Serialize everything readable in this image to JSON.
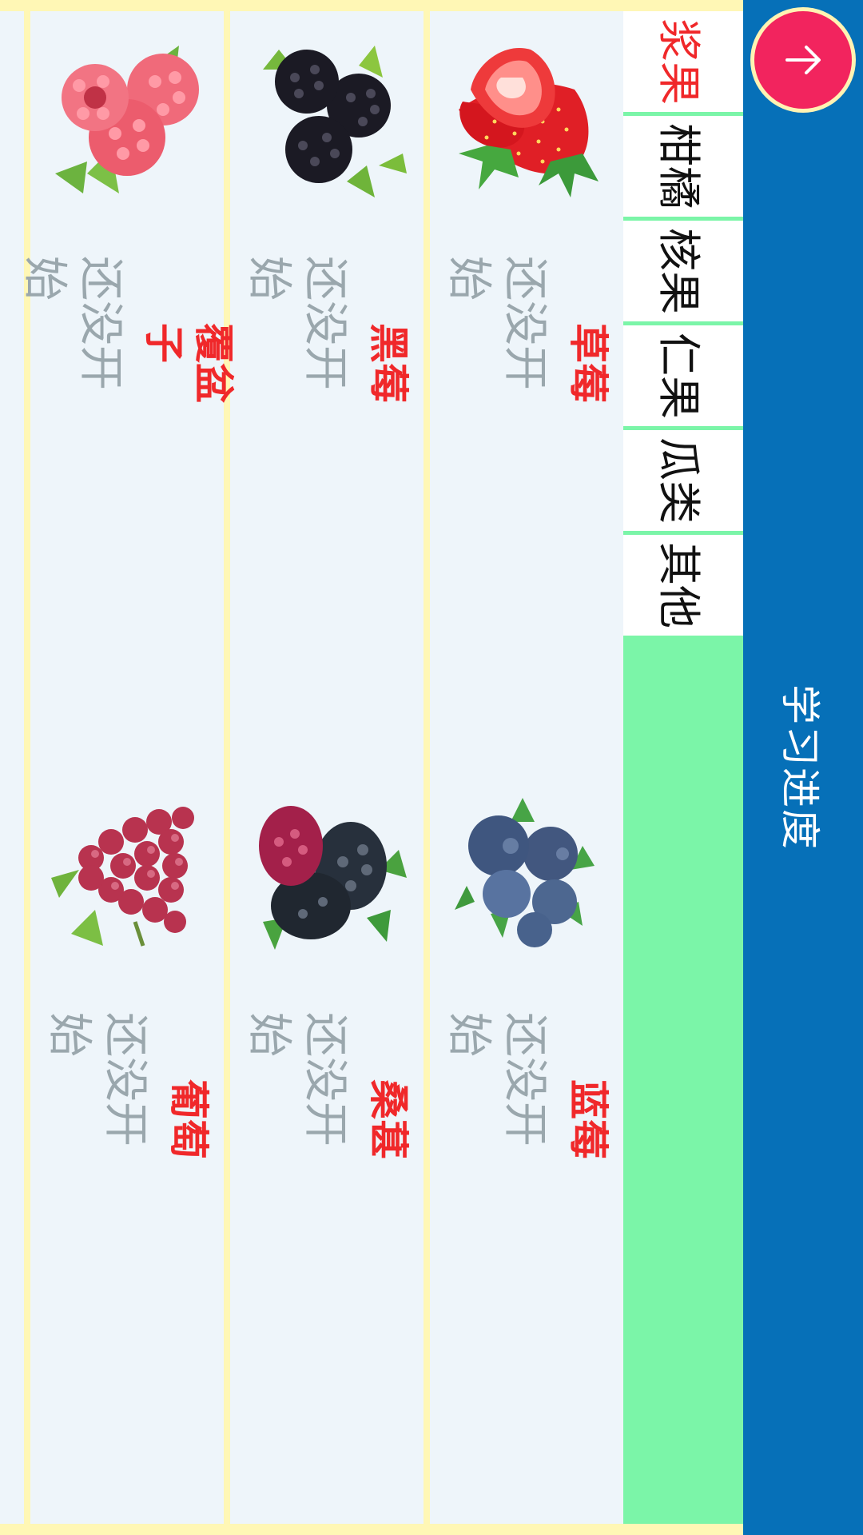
{
  "header": {
    "title": "学习进度",
    "up_icon": "arrow-up-icon",
    "accent": "#0670b8",
    "button_color": "#f2245e"
  },
  "tabs": [
    {
      "label": "浆果",
      "active": true
    },
    {
      "label": "柑橘",
      "active": false
    },
    {
      "label": "核果",
      "active": false
    },
    {
      "label": "仁果",
      "active": false
    },
    {
      "label": "瓜类",
      "active": false
    },
    {
      "label": "其他",
      "active": false
    }
  ],
  "fruits": [
    {
      "name": "草莓",
      "status": "还没开始",
      "icon": "strawberry-icon"
    },
    {
      "name": "蓝莓",
      "status": "还没开始",
      "icon": "blueberry-icon"
    },
    {
      "name": "黑莓",
      "status": "还没开始",
      "icon": "blackberry-icon"
    },
    {
      "name": "桑葚",
      "status": "还没开始",
      "icon": "mulberry-icon"
    },
    {
      "name": "覆盆子",
      "status": "还没开始",
      "icon": "raspberry-icon"
    },
    {
      "name": "葡萄",
      "status": "还没开始",
      "icon": "grape-icon"
    }
  ]
}
